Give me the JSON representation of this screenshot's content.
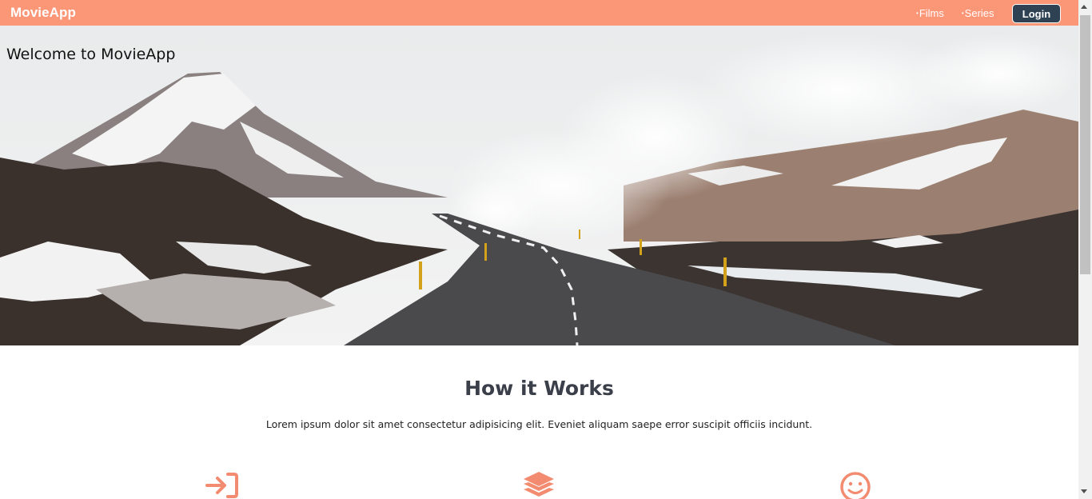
{
  "navbar": {
    "brand": "MovieApp",
    "links": [
      {
        "bullet": "•",
        "label": "Films"
      },
      {
        "bullet": "•",
        "label": "Series"
      }
    ],
    "login_label": "Login"
  },
  "hero": {
    "title": "Welcome to MovieApp"
  },
  "how_it_works": {
    "title": "How it Works",
    "text": "Lorem ipsum dolor sit amet consectetur adipisicing elit. Eveniet aliquam saepe error suscipit officiis incidunt.",
    "icons": [
      "login-arrow-icon",
      "layers-icon",
      "smile-icon"
    ]
  },
  "colors": {
    "navbar_bg": "#fb9677",
    "login_bg": "#2f4254",
    "icon_accent": "#f28b70",
    "heading": "#3b3f4a"
  }
}
